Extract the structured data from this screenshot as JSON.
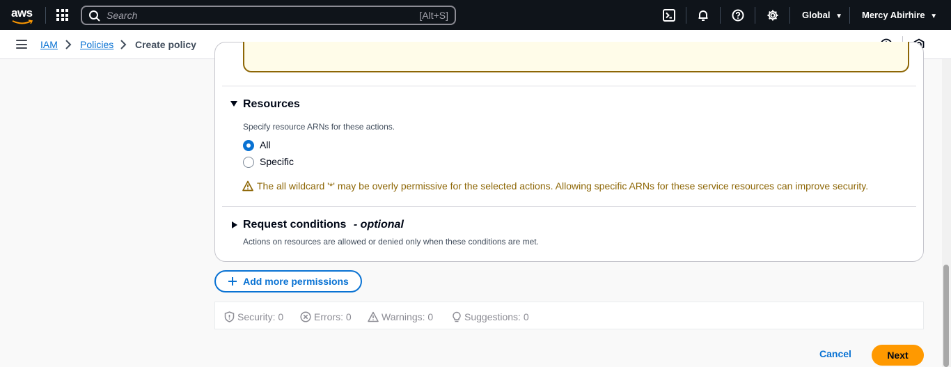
{
  "topnav": {
    "logo": "aws",
    "search_placeholder": "Search",
    "search_shortcut": "[Alt+S]",
    "region": "Global",
    "user": "Mercy Abirhire",
    "icons": [
      "grid-icon",
      "search-icon",
      "cloudshell-icon",
      "bell-icon",
      "help-icon",
      "gear-icon"
    ]
  },
  "breadcrumb": {
    "items": [
      "IAM",
      "Policies",
      "Create policy"
    ]
  },
  "resources": {
    "title": "Resources",
    "description": "Specify resource ARNs for these actions.",
    "options": [
      {
        "label": "All",
        "selected": true
      },
      {
        "label": "Specific",
        "selected": false
      }
    ],
    "warning": "The all wildcard '*' may be overly permissive for the selected actions. Allowing specific ARNs for these service resources can improve security."
  },
  "request_conditions": {
    "title": "Request conditions",
    "optional": "- optional",
    "description": "Actions on resources are allowed or denied only when these conditions are met."
  },
  "add_more_permissions": "Add more permissions",
  "status": {
    "security": "Security: 0",
    "errors": "Errors: 0",
    "warnings": "Warnings: 0",
    "suggestions": "Suggestions: 0"
  },
  "footer": {
    "cancel": "Cancel",
    "next": "Next"
  },
  "colors": {
    "accent": "#0972d3",
    "warning": "#8d6605",
    "primary_button": "#ff9900",
    "nav_bg": "#0f141a"
  }
}
